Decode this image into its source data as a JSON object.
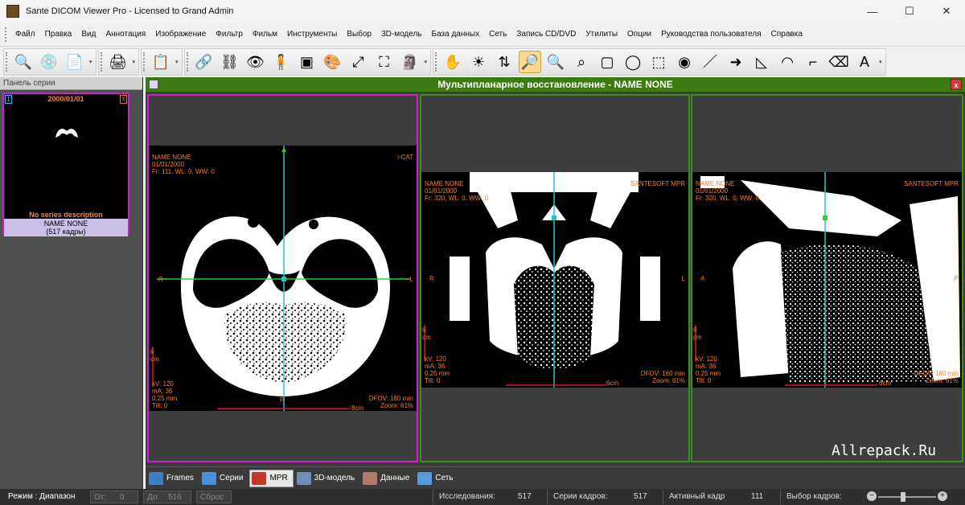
{
  "window": {
    "title": "Sante DICOM Viewer Pro - Licensed to Grand Admin",
    "minimize": "—",
    "maximize": "☐",
    "close": "✕"
  },
  "menu": [
    "Файл",
    "Правка",
    "Вид",
    "Аннотация",
    "Изображение",
    "Фильтр",
    "Фильм",
    "Инструменты",
    "Выбор",
    "3D-модель",
    "База данных",
    "Сеть",
    "Запись CD/DVD",
    "Утилиты",
    "Опции",
    "Руководства пользователя",
    "Справка"
  ],
  "toolbar": {
    "more": "▾",
    "group1": [
      {
        "icon": "open-study-icon",
        "glyph": "🔍"
      },
      {
        "icon": "cd-icon",
        "glyph": "💿"
      },
      {
        "icon": "document-icon",
        "glyph": "📄"
      }
    ],
    "group2": [
      {
        "icon": "print-icon",
        "glyph": "🖨"
      }
    ],
    "group3": [
      {
        "icon": "copy-icon",
        "glyph": "📋"
      }
    ],
    "group4": [
      {
        "icon": "link-icon",
        "glyph": "🔗"
      },
      {
        "icon": "unlink-icon",
        "glyph": "⛓"
      },
      {
        "icon": "eye-icon",
        "glyph": "👁"
      },
      {
        "icon": "body-icon",
        "glyph": "🧍"
      },
      {
        "icon": "mpr-view-icon",
        "glyph": "▣"
      },
      {
        "icon": "color-map-icon",
        "glyph": "🎨"
      },
      {
        "icon": "fit-window-icon",
        "glyph": "⤢"
      },
      {
        "icon": "full-screen-icon",
        "glyph": "⛶"
      },
      {
        "icon": "3d-head-icon",
        "glyph": "🗿"
      }
    ],
    "group5": [
      {
        "icon": "pan-hand-icon",
        "glyph": "✋"
      },
      {
        "icon": "brightness-icon",
        "glyph": "☀"
      },
      {
        "icon": "scroll-icon",
        "glyph": "⇅"
      },
      {
        "icon": "zoom-icon",
        "glyph": "🔎",
        "selected": true
      },
      {
        "icon": "magnify-region-icon",
        "glyph": "🔍"
      },
      {
        "icon": "zoom-fit-icon",
        "glyph": "⌕"
      },
      {
        "icon": "rectangle-roi-icon",
        "glyph": "▢"
      },
      {
        "icon": "ellipse-roi-icon",
        "glyph": "◯"
      },
      {
        "icon": "dashed-rect-icon",
        "glyph": "⬚"
      },
      {
        "icon": "color-wheel-icon",
        "glyph": "◉"
      },
      {
        "icon": "line-icon",
        "glyph": "／"
      },
      {
        "icon": "arrow-icon",
        "glyph": "➜"
      },
      {
        "icon": "angle-icon",
        "glyph": "◺"
      },
      {
        "icon": "protractor-icon",
        "glyph": "◠"
      },
      {
        "icon": "cobb-angle-icon",
        "glyph": "⌐"
      },
      {
        "icon": "eraser-icon",
        "glyph": "⌫"
      },
      {
        "icon": "text-annotation-icon",
        "glyph": "A"
      }
    ]
  },
  "series_panel": {
    "header": "Панель серии",
    "thumb": {
      "index": "1",
      "close": "X",
      "date": "2000/01/01",
      "description": "No series description",
      "name": "NAME NONE",
      "frames": "(517 кадры)"
    }
  },
  "mpr": {
    "title": "Мультипланарное восстановление - NAME NONE",
    "close": "x",
    "views": [
      {
        "name": "NAME NONE",
        "date": "01/01/2000",
        "params": "Fr: 111, WL: 0, WW: 0",
        "vendor": "i-CAT",
        "left": "R",
        "right": "L",
        "bottom_marker": "P",
        "scale_v": "6 cm",
        "scale_h": "8cm",
        "kv": "kV: 120",
        "ma": "mA: 36",
        "thickness": "0.25 mm",
        "tilt": "Tilt: 0",
        "dfov": "DFOV: 160 mm",
        "zoom": "Zoom: 61%"
      },
      {
        "name": "NAME NONE",
        "date": "01/01/2000",
        "params": "Fr: 320, WL: 0, WW: 0",
        "vendor": "SANTESOFT MPR",
        "left": "R",
        "right": "L",
        "bottom_marker": "",
        "scale_v": "6 cm",
        "scale_h": "6cm",
        "kv": "kV: 120",
        "ma": "mA: 36",
        "thickness": "0.25 mm",
        "tilt": "Tilt: 0",
        "dfov": "DFOV: 160 mm",
        "zoom": "Zoom: 61%"
      },
      {
        "name": "NAME NONE",
        "date": "01/01/2000",
        "params": "Fr: 320, WL: 0, WW: 0",
        "vendor": "SANTESOFT MPR",
        "left": "A",
        "right": "P",
        "bottom_marker": "",
        "scale_v": "6 cm",
        "scale_h": "6cm",
        "kv": "kV: 120",
        "ma": "mA: 36",
        "thickness": "0.25 mm",
        "tilt": "Tilt: 0",
        "dfov": "DFOV: 160 mm",
        "zoom": "Zoom: 61%"
      }
    ],
    "tabs": [
      {
        "label": "Frames",
        "icon": "frames-icon",
        "color": "#3f7fc0"
      },
      {
        "label": "Серии",
        "icon": "series-icon",
        "color": "#4a90d9"
      },
      {
        "label": "MPR",
        "icon": "mpr-icon",
        "color": "#c0392b",
        "active": true
      },
      {
        "label": "3D-модель",
        "icon": "3d-model-icon",
        "color": "#6b8fb5"
      },
      {
        "label": "Данные",
        "icon": "data-icon",
        "color": "#b07a6a"
      },
      {
        "label": "Сеть",
        "icon": "network-icon",
        "color": "#5a9ad6"
      }
    ]
  },
  "status": {
    "mode": "Режим : Диапазон",
    "from_label": "От:",
    "from_value": "0",
    "to_label": "До:",
    "to_value": "516",
    "reset": "Сброс",
    "studies_label": "Исследования:",
    "studies_value": "517",
    "series_frames_label": "Серии кадров:",
    "series_frames_value": "517",
    "active_frame_label": "Активный кадр",
    "active_frame_value": "111",
    "frame_select_label": "Выбор кадров:",
    "zoom_minus": "−",
    "zoom_plus": "+"
  },
  "watermark": "Allrepack.Ru",
  "colors": {
    "mpr_title_bg": "#3a7b12",
    "active_view_border": "#d11cd1",
    "inactive_view_border": "#3a8f1c",
    "overlay_text": "#ff7a1a",
    "crosshair_vertical": "#22c7c7",
    "crosshair_horizontal": "#2ed12e",
    "scale_bar": "#e0162c"
  }
}
